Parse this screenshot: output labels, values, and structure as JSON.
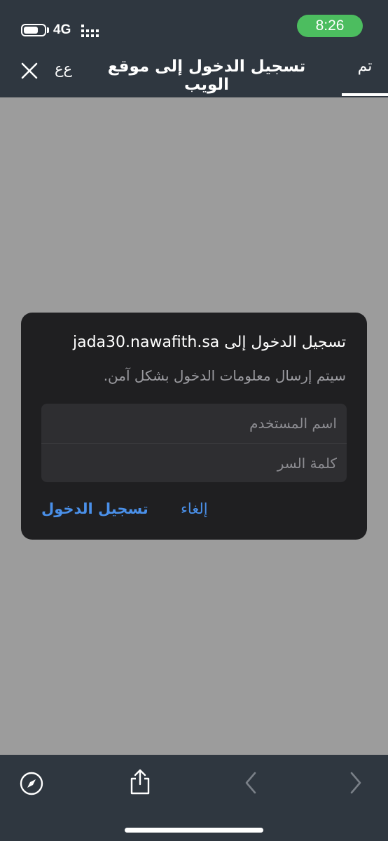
{
  "status_bar": {
    "network": "4G",
    "time": "8:26"
  },
  "nav_bar": {
    "title": "تسجيل الدخول إلى موقع الويب",
    "text_size_label": "ﻉﻉ",
    "done_label": "تم"
  },
  "dialog": {
    "title": "تسجيل الدخول إلى jada30.nawafith.sa",
    "message": "سيتم إرسال معلومات الدخول بشكل آمن.",
    "username_placeholder": "اسم المستخدم",
    "password_placeholder": "كلمة السر",
    "cancel_label": "إلغاء",
    "login_label": "تسجيل الدخول"
  },
  "toolbar": {
    "icons": [
      "compass-icon",
      "share-icon",
      "back-icon",
      "forward-icon"
    ]
  },
  "colors": {
    "bar_bg": "#2f3740",
    "page_bg": "#9c9c9c",
    "dialog_bg": "#1f1f21",
    "accent": "#4a90e9",
    "time_pill": "#4cbd5f"
  }
}
